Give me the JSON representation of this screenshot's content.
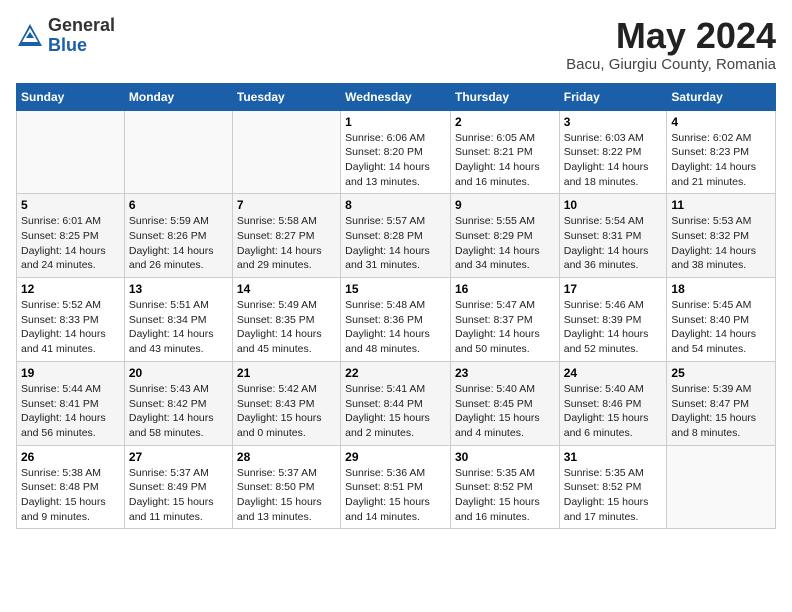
{
  "header": {
    "logo_general": "General",
    "logo_blue": "Blue",
    "month": "May 2024",
    "location": "Bacu, Giurgiu County, Romania"
  },
  "weekdays": [
    "Sunday",
    "Monday",
    "Tuesday",
    "Wednesday",
    "Thursday",
    "Friday",
    "Saturday"
  ],
  "weeks": [
    [
      {
        "day": "",
        "info": ""
      },
      {
        "day": "",
        "info": ""
      },
      {
        "day": "",
        "info": ""
      },
      {
        "day": "1",
        "info": "Sunrise: 6:06 AM\nSunset: 8:20 PM\nDaylight: 14 hours\nand 13 minutes."
      },
      {
        "day": "2",
        "info": "Sunrise: 6:05 AM\nSunset: 8:21 PM\nDaylight: 14 hours\nand 16 minutes."
      },
      {
        "day": "3",
        "info": "Sunrise: 6:03 AM\nSunset: 8:22 PM\nDaylight: 14 hours\nand 18 minutes."
      },
      {
        "day": "4",
        "info": "Sunrise: 6:02 AM\nSunset: 8:23 PM\nDaylight: 14 hours\nand 21 minutes."
      }
    ],
    [
      {
        "day": "5",
        "info": "Sunrise: 6:01 AM\nSunset: 8:25 PM\nDaylight: 14 hours\nand 24 minutes."
      },
      {
        "day": "6",
        "info": "Sunrise: 5:59 AM\nSunset: 8:26 PM\nDaylight: 14 hours\nand 26 minutes."
      },
      {
        "day": "7",
        "info": "Sunrise: 5:58 AM\nSunset: 8:27 PM\nDaylight: 14 hours\nand 29 minutes."
      },
      {
        "day": "8",
        "info": "Sunrise: 5:57 AM\nSunset: 8:28 PM\nDaylight: 14 hours\nand 31 minutes."
      },
      {
        "day": "9",
        "info": "Sunrise: 5:55 AM\nSunset: 8:29 PM\nDaylight: 14 hours\nand 34 minutes."
      },
      {
        "day": "10",
        "info": "Sunrise: 5:54 AM\nSunset: 8:31 PM\nDaylight: 14 hours\nand 36 minutes."
      },
      {
        "day": "11",
        "info": "Sunrise: 5:53 AM\nSunset: 8:32 PM\nDaylight: 14 hours\nand 38 minutes."
      }
    ],
    [
      {
        "day": "12",
        "info": "Sunrise: 5:52 AM\nSunset: 8:33 PM\nDaylight: 14 hours\nand 41 minutes."
      },
      {
        "day": "13",
        "info": "Sunrise: 5:51 AM\nSunset: 8:34 PM\nDaylight: 14 hours\nand 43 minutes."
      },
      {
        "day": "14",
        "info": "Sunrise: 5:49 AM\nSunset: 8:35 PM\nDaylight: 14 hours\nand 45 minutes."
      },
      {
        "day": "15",
        "info": "Sunrise: 5:48 AM\nSunset: 8:36 PM\nDaylight: 14 hours\nand 48 minutes."
      },
      {
        "day": "16",
        "info": "Sunrise: 5:47 AM\nSunset: 8:37 PM\nDaylight: 14 hours\nand 50 minutes."
      },
      {
        "day": "17",
        "info": "Sunrise: 5:46 AM\nSunset: 8:39 PM\nDaylight: 14 hours\nand 52 minutes."
      },
      {
        "day": "18",
        "info": "Sunrise: 5:45 AM\nSunset: 8:40 PM\nDaylight: 14 hours\nand 54 minutes."
      }
    ],
    [
      {
        "day": "19",
        "info": "Sunrise: 5:44 AM\nSunset: 8:41 PM\nDaylight: 14 hours\nand 56 minutes."
      },
      {
        "day": "20",
        "info": "Sunrise: 5:43 AM\nSunset: 8:42 PM\nDaylight: 14 hours\nand 58 minutes."
      },
      {
        "day": "21",
        "info": "Sunrise: 5:42 AM\nSunset: 8:43 PM\nDaylight: 15 hours\nand 0 minutes."
      },
      {
        "day": "22",
        "info": "Sunrise: 5:41 AM\nSunset: 8:44 PM\nDaylight: 15 hours\nand 2 minutes."
      },
      {
        "day": "23",
        "info": "Sunrise: 5:40 AM\nSunset: 8:45 PM\nDaylight: 15 hours\nand 4 minutes."
      },
      {
        "day": "24",
        "info": "Sunrise: 5:40 AM\nSunset: 8:46 PM\nDaylight: 15 hours\nand 6 minutes."
      },
      {
        "day": "25",
        "info": "Sunrise: 5:39 AM\nSunset: 8:47 PM\nDaylight: 15 hours\nand 8 minutes."
      }
    ],
    [
      {
        "day": "26",
        "info": "Sunrise: 5:38 AM\nSunset: 8:48 PM\nDaylight: 15 hours\nand 9 minutes."
      },
      {
        "day": "27",
        "info": "Sunrise: 5:37 AM\nSunset: 8:49 PM\nDaylight: 15 hours\nand 11 minutes."
      },
      {
        "day": "28",
        "info": "Sunrise: 5:37 AM\nSunset: 8:50 PM\nDaylight: 15 hours\nand 13 minutes."
      },
      {
        "day": "29",
        "info": "Sunrise: 5:36 AM\nSunset: 8:51 PM\nDaylight: 15 hours\nand 14 minutes."
      },
      {
        "day": "30",
        "info": "Sunrise: 5:35 AM\nSunset: 8:52 PM\nDaylight: 15 hours\nand 16 minutes."
      },
      {
        "day": "31",
        "info": "Sunrise: 5:35 AM\nSunset: 8:52 PM\nDaylight: 15 hours\nand 17 minutes."
      },
      {
        "day": "",
        "info": ""
      }
    ]
  ]
}
